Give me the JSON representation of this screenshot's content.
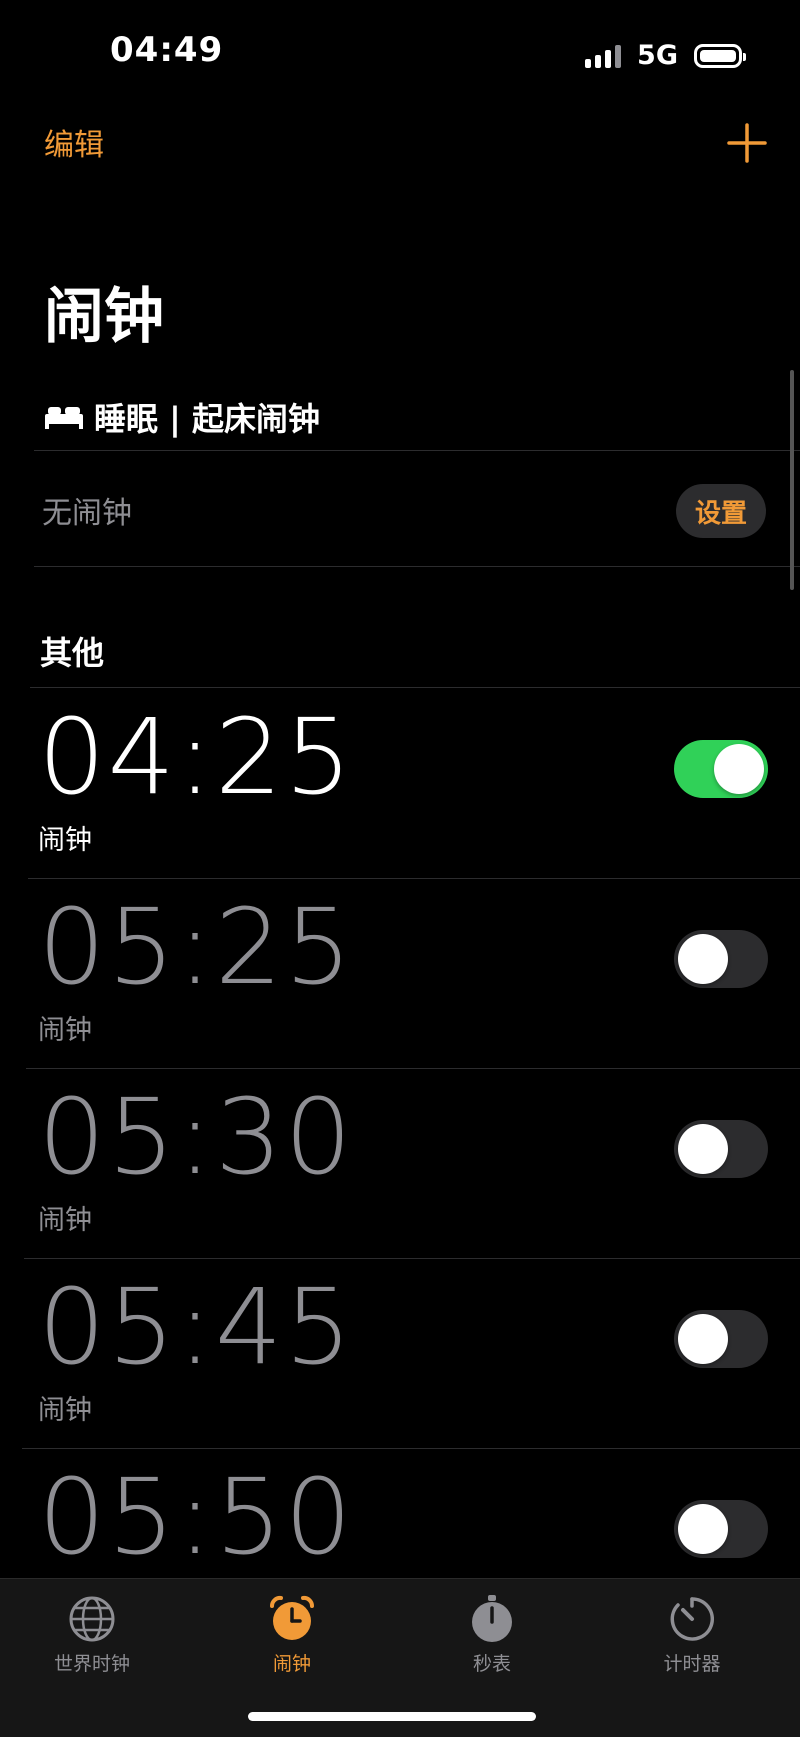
{
  "status_bar": {
    "time": "04:49",
    "network": "5G"
  },
  "nav": {
    "edit_label": "编辑",
    "add_icon": "plus-icon"
  },
  "page_title": "闹钟",
  "sleep": {
    "header": "睡眠 | 起床闹钟",
    "icon": "bed-icon",
    "no_alarm": "无闹钟",
    "set_label": "设置"
  },
  "section_other": "其他",
  "alarms": [
    {
      "time": "04:25",
      "label": "闹钟",
      "enabled": true
    },
    {
      "time": "05:25",
      "label": "闹钟",
      "enabled": false
    },
    {
      "time": "05:30",
      "label": "闹钟",
      "enabled": false
    },
    {
      "time": "05:45",
      "label": "闹钟",
      "enabled": false
    },
    {
      "time": "05:50",
      "label": "",
      "enabled": false
    }
  ],
  "tabs": [
    {
      "label": "世界时钟",
      "icon": "globe-icon",
      "active": false
    },
    {
      "label": "闹钟",
      "icon": "alarm-clock-icon",
      "active": true
    },
    {
      "label": "秒表",
      "icon": "stopwatch-icon",
      "active": false
    },
    {
      "label": "计时器",
      "icon": "timer-icon",
      "active": false
    }
  ],
  "colors": {
    "accent": "#f19a37",
    "toggle_on": "#30d158",
    "secondary_text": "#8e8e93",
    "background": "#000000"
  }
}
